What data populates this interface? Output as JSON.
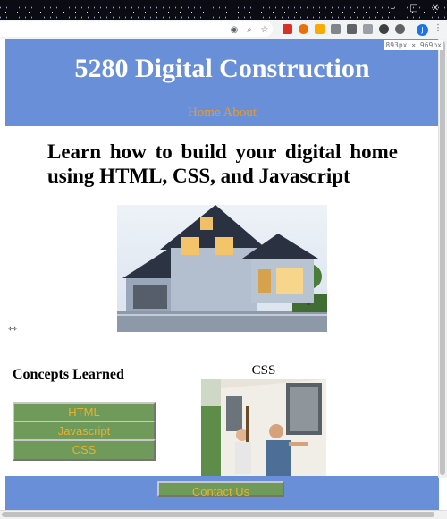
{
  "browser": {
    "viewport_size_label": "893px × 969px",
    "profile_initial": "J"
  },
  "site": {
    "title": "5280 Digital Construction",
    "nav": [
      {
        "label": "Home"
      },
      {
        "label": "About"
      }
    ]
  },
  "main": {
    "headline": "Learn how to build your digital home using HTML, CSS, and Javascript",
    "concepts": {
      "title": "Concepts Learned",
      "buttons": [
        {
          "label": "HTML"
        },
        {
          "label": "Javascript"
        },
        {
          "label": "CSS"
        }
      ]
    },
    "featured_caption": "CSS"
  },
  "footer": {
    "contact_label": "Contact Us"
  },
  "colors": {
    "header_bg": "#6a8fd9",
    "nav_text": "#e89a2e",
    "button_bg": "#6f9a5a",
    "button_text": "#e8b22f"
  }
}
